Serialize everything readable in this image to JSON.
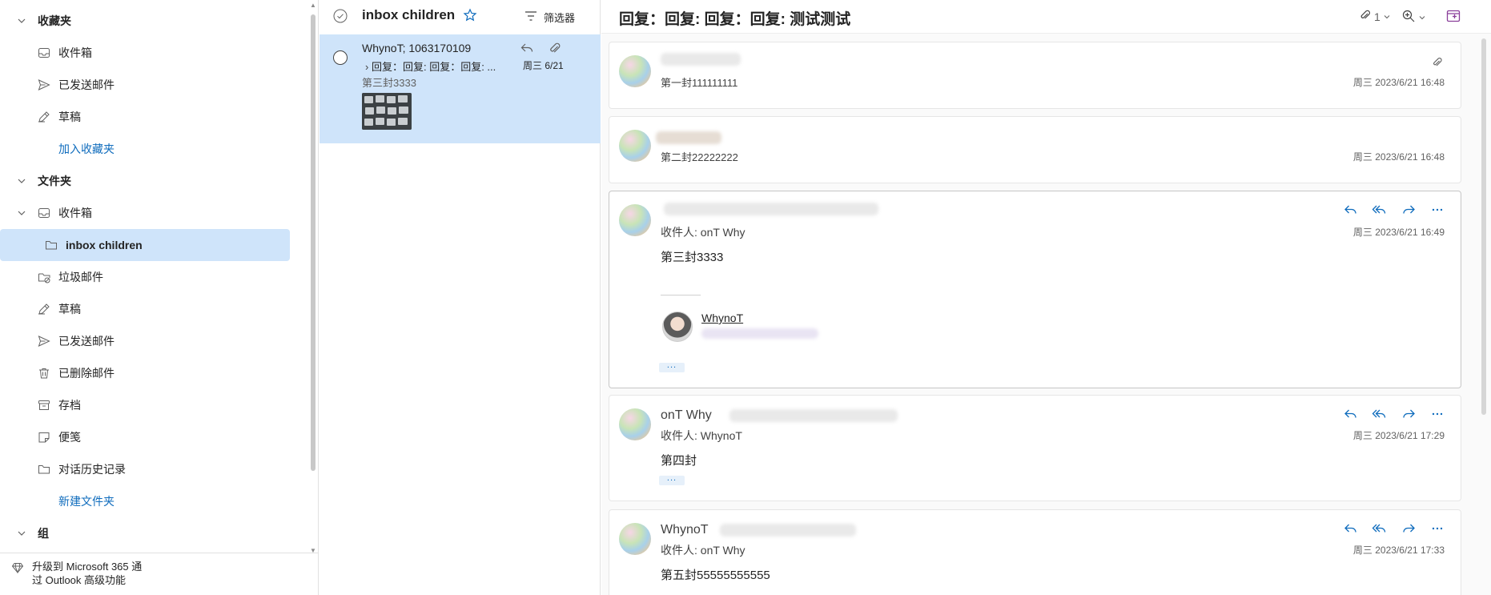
{
  "nav": {
    "favorites_label": "收藏夹",
    "favorites": [
      {
        "label": "收件箱",
        "icon": "inbox-icon"
      },
      {
        "label": "已发送邮件",
        "icon": "send-icon"
      },
      {
        "label": "草稿",
        "icon": "pencil-icon"
      }
    ],
    "add_favorite": "加入收藏夹",
    "folders_label": "文件夹",
    "inbox": "收件箱",
    "inbox_child": "inbox children",
    "folders": [
      {
        "label": "垃圾邮件",
        "icon": "junk-icon"
      },
      {
        "label": "草稿",
        "icon": "pencil-icon"
      },
      {
        "label": "已发送邮件",
        "icon": "send-icon"
      },
      {
        "label": "已删除邮件",
        "icon": "trash-icon"
      },
      {
        "label": "存档",
        "icon": "archive-icon"
      },
      {
        "label": "便笺",
        "icon": "note-icon"
      },
      {
        "label": "对话历史记录",
        "icon": "folder-icon"
      }
    ],
    "new_folder": "新建文件夹",
    "groups_label": "组",
    "upgrade_line1": "升级到 Microsoft 365 通",
    "upgrade_line2": "过 Outlook 高级功能"
  },
  "list": {
    "title": "inbox children",
    "filter_label": "筛选器",
    "item": {
      "sender": "WhynoT; 1063170109",
      "subject": "回复：回复: 回复：回复: ...",
      "date": "周三 6/21",
      "preview": "第三封3333"
    }
  },
  "reading": {
    "subject": "回复：回复: 回复：回复: 测试测试",
    "attach_count": "1",
    "messages": [
      {
        "snippet": "第一封111111111",
        "date": "周三 2023/6/21 16:48"
      },
      {
        "snippet": "第二封22222222",
        "date": "周三 2023/6/21 16:48"
      },
      {
        "to": "收件人:  onT Why",
        "body": "第三封3333",
        "date": "周三 2023/6/21 16:49",
        "signature_name": "WhynoT"
      },
      {
        "name": "onT Why",
        "to": "收件人:  WhynoT",
        "body": "第四封",
        "date": "周三 2023/6/21 17:29"
      },
      {
        "name": "WhynoT",
        "to": "收件人:  onT Why",
        "body": "第五封55555555555",
        "date": "周三 2023/6/21 17:33"
      }
    ]
  },
  "colors": {
    "accent": "#0f6cbd",
    "selected": "#cfe4fa"
  }
}
